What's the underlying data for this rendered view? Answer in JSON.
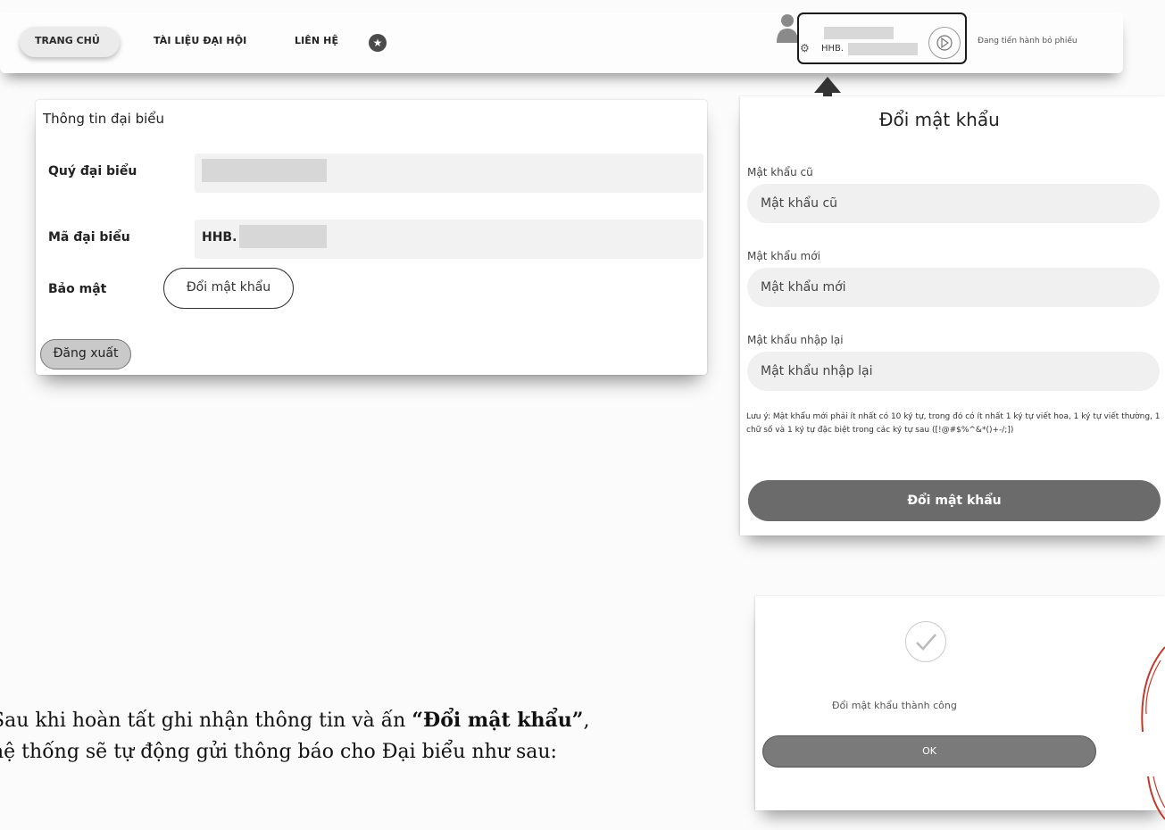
{
  "nav": {
    "items": [
      "TRANG CHỦ",
      "TÀI LIỆU ĐẠI HỘI",
      "LIÊN HỆ"
    ],
    "user_code": "HHB.",
    "voting_status": "Đang tiến hành bỏ phiếu"
  },
  "info": {
    "title": "Thông tin đại biểu",
    "rows": [
      {
        "label": "Quý đại biểu",
        "value": ""
      },
      {
        "label": "Mã đại biểu",
        "value": "HHB."
      },
      {
        "label": "Bảo mật",
        "value": ""
      }
    ],
    "change_password_label": "Đổi mật khẩu",
    "logout_label": "Đăng xuất"
  },
  "password_form": {
    "title": "Đổi mật khẩu",
    "fields": [
      {
        "label": "Mật khẩu cũ",
        "placeholder": "Mật khẩu cũ"
      },
      {
        "label": "Mật khẩu mới",
        "placeholder": "Mật khẩu mới"
      },
      {
        "label": "Mật khẩu nhập lại",
        "placeholder": "Mật khẩu nhập lại"
      }
    ],
    "note": "Lưu ý: Mật khẩu mới phải ít nhất có 10 ký tự, trong đó có ít nhất 1 ký tự viết hoa, 1 ký tự viết thường, 1 chữ số và 1 ký tự đặc biệt trong các ký tự sau ([!@#$%^&*()+-/;])",
    "submit_label": "Đổi mật khẩu"
  },
  "success_dialog": {
    "message": "Đổi mật khẩu thành công",
    "ok_label": "OK"
  },
  "document": {
    "line1_prefix": "Sau khi hoàn tất ghi nhận thông tin và ấn ",
    "line1_bold": "“Đổi mật khẩu”",
    "line1_suffix": ",",
    "line2": "hệ thống sẽ tự động gửi thông báo cho Đại biểu như sau:"
  },
  "colors": {
    "primary_button": "#6b6b6b",
    "input_background": "#f0f0f0",
    "highlight_border": "#1b1b1b",
    "stamp": "#c0392b"
  },
  "icons": [
    "star-icon",
    "user-avatar-icon",
    "gear-icon",
    "arrow-circle-icon",
    "up-arrow-icon",
    "check-icon"
  ]
}
